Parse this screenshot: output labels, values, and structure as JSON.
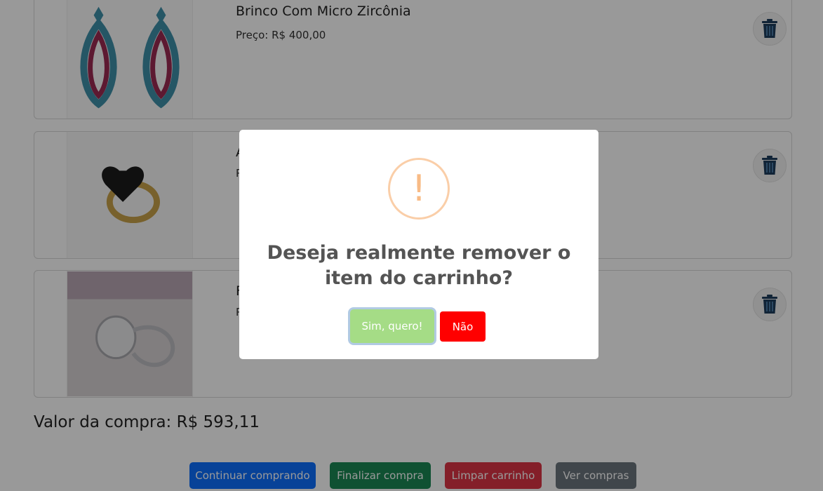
{
  "cart": {
    "items": [
      {
        "name": "Brinco Com Micro Zircônia",
        "price": "Preço: R$ 400,00",
        "image": "earrings",
        "top_visible": true
      },
      {
        "name": "A",
        "price": "P",
        "image": "heart-ring"
      },
      {
        "name": "F",
        "price": "P",
        "image": "signet-ring"
      }
    ]
  },
  "summary": {
    "total": "Valor da compra: R$ 593,11"
  },
  "actions": {
    "continue": "Continuar comprando",
    "checkout": "Finalizar compra",
    "clear": "Limpar carrinho",
    "orders": "Ver compras"
  },
  "modal": {
    "icon": "!",
    "title": "Deseja realmente remover o item do carrinho?",
    "confirm": "Sim, quero!",
    "cancel": "Não"
  },
  "colors": {
    "primary": "#0d6efd",
    "success": "#198754",
    "danger": "#dc3545",
    "secondary": "#6c757d",
    "confirm": "#a5dc86",
    "cancel": "#ff0000",
    "warning_icon": "#f8bb86"
  }
}
